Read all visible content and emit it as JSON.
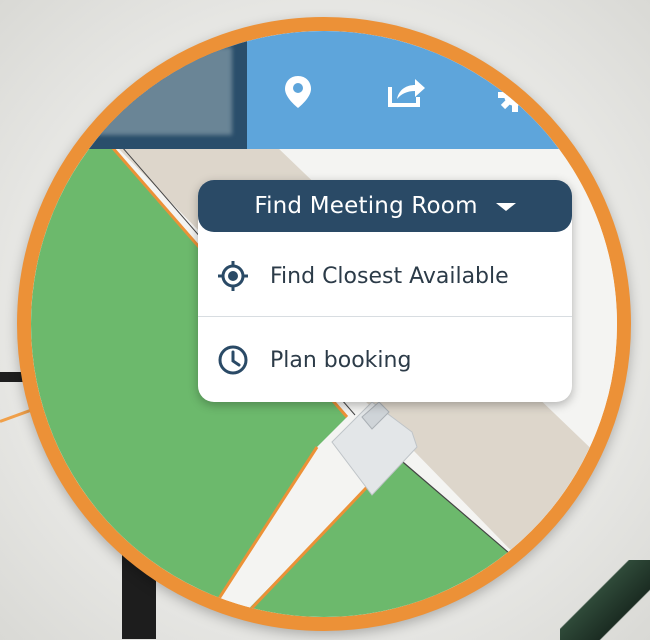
{
  "toolbar": {
    "icons": [
      "location-pin-icon",
      "share-icon",
      "gear-icon"
    ]
  },
  "dropdown": {
    "title": "Find Meeting Room",
    "items": [
      {
        "label": "Find Closest Available",
        "icon": "target-icon"
      },
      {
        "label": "Plan booking",
        "icon": "clock-icon"
      }
    ]
  },
  "colors": {
    "ring": "#ec9137",
    "toolbar": "#5ea5db",
    "header": "#2a4a66",
    "room_available": "#6cb96c",
    "corridor": "#ddd6cb"
  }
}
